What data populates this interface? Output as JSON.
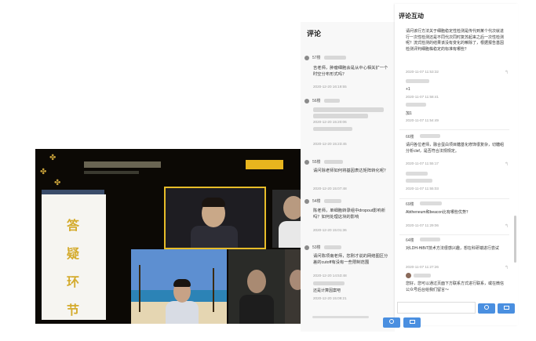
{
  "interaction": {
    "title": "评论互动",
    "messages": [
      {
        "text": "请问该行方法关于细胞稳定性检测是传代到某个代次就进行一次性检测还是不同代次同时复苏起来之后一次性检测呢？流式检测的结果该没有变化的嘛除了，根据报告基因检测评判细胞株稳定的标准有哪些？",
        "time": "2020-11-07 11:53:32"
      },
      {
        "text": "+1",
        "time": "2020-11-07 11:58:41"
      },
      {
        "text": "加1",
        "time": "2020-11-07 11:54:49"
      },
      {
        "floor": "66楼",
        "text": "请问各位老师，融合蛋白项目糖基化修饰很复杂，切糖组分析clef，是否符合法规规定。",
        "time": "2020-11-07 11:55:17"
      },
      {
        "time": "2020-11-07 11:55:03"
      },
      {
        "floor": "69楼",
        "text": "Abtheneum和beacon比有哪些优势？",
        "time": "2020-11-07 11:29:06"
      },
      {
        "floor": "64楼",
        "text": "对LDH-HiBiT技术方法很感兴趣，想在科研端进行尝试",
        "time": "2020-11-07 11:27:26"
      },
      {
        "text": "您好，您可以通过页面下方联系方式进行联系，或在微信公众号后台给我们留言～"
      }
    ]
  },
  "comments": {
    "title": "评论",
    "items": [
      {
        "floor": "57楼",
        "text": "吉老师，肿瘤细胞会是从中心相关扩一个时空分布形式吗？",
        "time": "2020-12-20 16:19:55"
      },
      {
        "floor": "56楼",
        "time": "2020-12-20 15:20:06",
        "sub_time": "2020-12-20 15:23:45"
      },
      {
        "floor": "55楼",
        "text": "请问除老师如何将基因表达矩阵转化呢？",
        "time": "2020-12-20 15:07:48"
      },
      {
        "floor": "54楼",
        "text": "陈老师，单细胞转录组中dropout影响析吗？如何处理这块的影响",
        "time": "2020-12-20 15:01:36"
      },
      {
        "floor": "53楼",
        "text": "请问陈项南老师，您刚才说的网络图区分差的cutoff有没有一些限制范围",
        "time": "2020-12-20 14:53:48",
        "reply": "还是计算因案吧",
        "reply_time": "2020-12-20 15:09:21"
      }
    ]
  },
  "video": {
    "card_chars": [
      "答",
      "疑",
      "环",
      "节"
    ]
  },
  "colors": {
    "accent": "#4a8fe0",
    "gold": "#d4ab2d"
  }
}
